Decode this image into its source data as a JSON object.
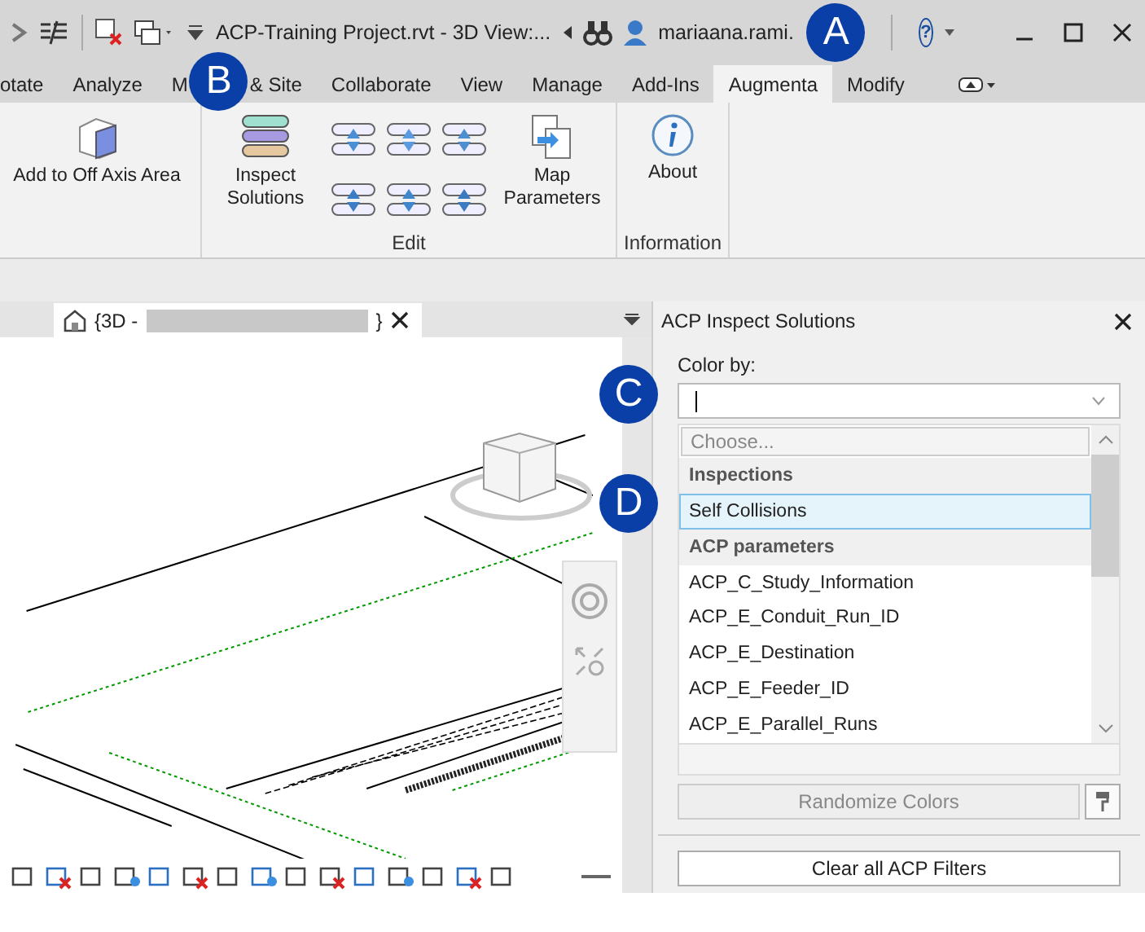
{
  "title_bar": {
    "document_title": "ACP-Training Project.rvt - 3D View:...",
    "user": "mariaana.rami.",
    "help": "?"
  },
  "ribbon_tabs": [
    {
      "label": "otate",
      "selected": false
    },
    {
      "label": "Analyze",
      "selected": false
    },
    {
      "label_parts": [
        "M",
        "& Site"
      ],
      "selected": false
    },
    {
      "label": "Collaborate",
      "selected": false
    },
    {
      "label": "View",
      "selected": false
    },
    {
      "label": "Manage",
      "selected": false
    },
    {
      "label": "Add-Ins",
      "selected": false
    },
    {
      "label": "Augmenta",
      "selected": true
    },
    {
      "label": "Modify",
      "selected": false
    }
  ],
  "ribbon_panels": [
    {
      "buttons": [
        {
          "kind": "large",
          "label": "Add to Off Axis Area"
        }
      ]
    },
    {
      "title": "Edit",
      "buttons": [
        {
          "kind": "large",
          "label": "Inspect Solutions"
        },
        {
          "kind": "small"
        },
        {
          "kind": "small"
        },
        {
          "kind": "small"
        },
        {
          "kind": "small"
        },
        {
          "kind": "small"
        },
        {
          "kind": "small"
        },
        {
          "kind": "large",
          "label": "Map Parameters"
        }
      ]
    },
    {
      "title": "Information",
      "buttons": [
        {
          "kind": "large",
          "label": "About"
        }
      ]
    }
  ],
  "view_tab": {
    "label_start": "{3D -",
    "label_end": "}"
  },
  "inspect_panel": {
    "title": "ACP Inspect Solutions",
    "color_by_label": "Color by:",
    "dropdown": {
      "placeholder": "Choose...",
      "items": [
        {
          "kind": "header",
          "label": "Inspections"
        },
        {
          "kind": "option",
          "label": "Self Collisions",
          "selected": true
        },
        {
          "kind": "header",
          "label": "ACP parameters"
        },
        {
          "kind": "option",
          "label": "ACP_C_Study_Information",
          "selected": false
        },
        {
          "kind": "option",
          "label": "ACP_E_Conduit_Run_ID",
          "selected": false
        },
        {
          "kind": "option",
          "label": "ACP_E_Destination",
          "selected": false
        },
        {
          "kind": "option",
          "label": "ACP_E_Feeder_ID",
          "selected": false
        },
        {
          "kind": "option",
          "label": "ACP_E_Parallel_Runs",
          "selected": false
        }
      ]
    },
    "randomize_button": {
      "label": "Randomize Colors",
      "disabled": true
    },
    "clear_button": {
      "label": "Clear all ACP Filters",
      "disabled": false
    }
  },
  "callouts": [
    {
      "letter": "A"
    },
    {
      "letter": "B"
    },
    {
      "letter": "C"
    },
    {
      "letter": "D"
    }
  ]
}
